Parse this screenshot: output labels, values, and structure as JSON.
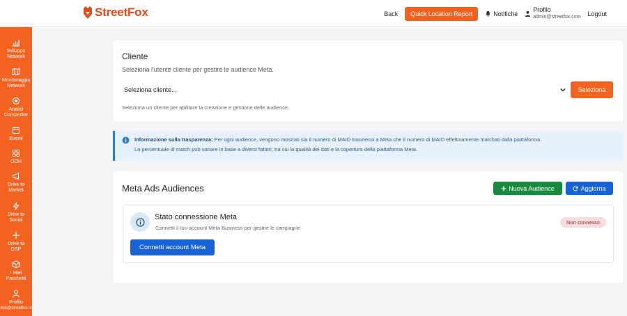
{
  "header": {
    "brand": "StreetFox",
    "nav": {
      "back": "Back",
      "quick_report": "Quick Location Report",
      "notifications": "Notifiche",
      "profile_name": "Profilo",
      "profile_email": "admin@streetfox.com",
      "logout": "Logout"
    }
  },
  "sidebar": {
    "items": [
      {
        "label": "Sviluppo\nNetwork",
        "icon": "bar-chart-icon"
      },
      {
        "label": "Monitoraggio\nNetwork",
        "icon": "map-icon"
      },
      {
        "label": "Analisi\nCompetitor",
        "icon": "target-icon"
      },
      {
        "label": "Eventi",
        "icon": "calendar-icon"
      },
      {
        "label": "OOH",
        "icon": "grid-icon"
      },
      {
        "label": "Drive to\nMarket",
        "icon": "megaphone-icon"
      },
      {
        "label": "Drive to\nSocial",
        "icon": "bolt-icon"
      },
      {
        "label": "Drive to\nDSP",
        "icon": "plus-icon"
      },
      {
        "label": "I Miei\nPacchetti",
        "icon": "box-icon"
      },
      {
        "label": "Profilo",
        "icon": "user-icon"
      },
      {
        "label": "admin@streetfox.com",
        "icon": ""
      }
    ]
  },
  "cliente": {
    "title": "Cliente",
    "subtitle": "Seleziona l'utente cliente per gestire le audience Meta.",
    "select_value": "Seleziona cliente...",
    "button": "Seleziona",
    "hint": "Seleziona un cliente per abilitare la creazione e gestione delle audience."
  },
  "info": {
    "bold": "Informazione sulla trasparenza:",
    "line1": " Per ogni audience, vengono mostrati sia il numero di MAID trasmessi a Meta che il numero di MAID effettivamente matchati dalla piattaforma.",
    "line2": "La percentuale di match può variare in base a diversi fattori, tra cui la qualità dei dati e la copertura della piattaforma Meta."
  },
  "meta": {
    "title": "Meta Ads Audiences",
    "new_button": "Nuova Audience",
    "refresh_button": "Aggiorna",
    "connection": {
      "title": "Stato connessione Meta",
      "subtitle": "Connetti il tuo account Meta Business per gestire le campagne",
      "status": "Non connesso",
      "connect_button": "Connetti account Meta"
    }
  },
  "colors": {
    "brand": "#f4621f",
    "success": "#19893f",
    "primary": "#1662d6",
    "info_bg": "#e7f1fb",
    "danger_bg": "#fbdcdc"
  }
}
